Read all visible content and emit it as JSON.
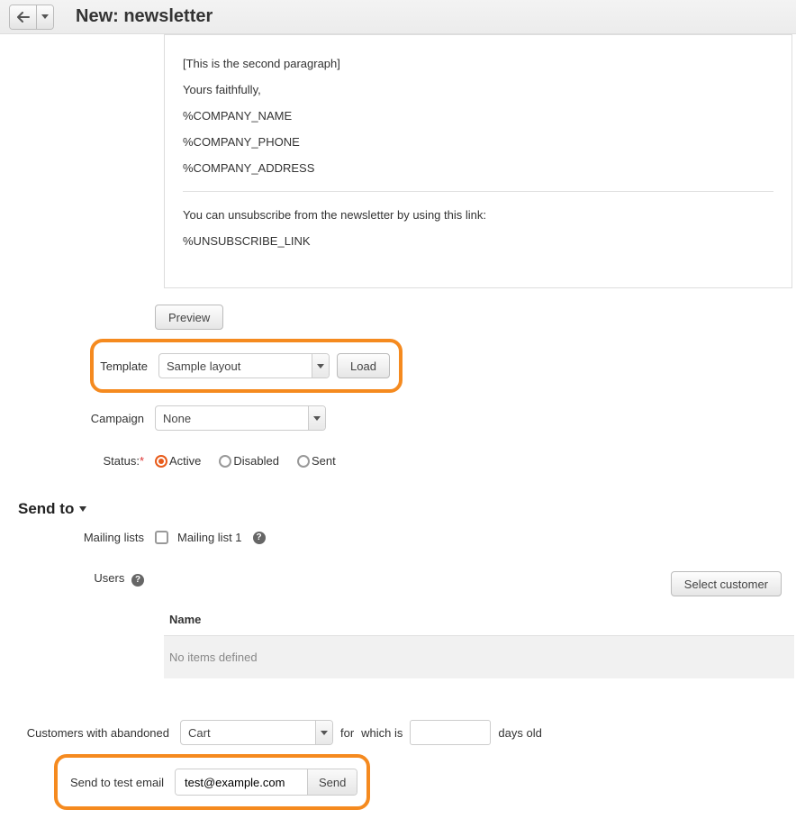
{
  "header": {
    "title": "New: newsletter"
  },
  "body_preview": {
    "lines": [
      "[This is the second paragraph]",
      "Yours faithfully,",
      "%COMPANY_NAME",
      "%COMPANY_PHONE",
      "%COMPANY_ADDRESS"
    ],
    "unsubscribe_text": "You can unsubscribe from the newsletter by using this link:",
    "unsubscribe_token": "%UNSUBSCRIBE_LINK"
  },
  "buttons": {
    "preview": "Preview",
    "load": "Load",
    "select_customer": "Select customer",
    "send": "Send"
  },
  "labels": {
    "template": "Template",
    "campaign": "Campaign",
    "status": "Status:",
    "mailing_lists": "Mailing lists",
    "users": "Users",
    "customers_abandoned": "Customers with abandoned",
    "for": "for",
    "which_is": "which is",
    "days_old": "days old",
    "send_test": "Send to test email"
  },
  "template_select": "Sample layout",
  "campaign_select": "None",
  "status_options": {
    "active": "Active",
    "disabled": "Disabled",
    "sent": "Sent"
  },
  "section_send_to": "Send to",
  "mailing_list_1": "Mailing list 1",
  "table": {
    "col_name": "Name",
    "empty": "No items defined"
  },
  "abandoned_select": "Cart",
  "days_value": "",
  "test_email": "test@example.com"
}
